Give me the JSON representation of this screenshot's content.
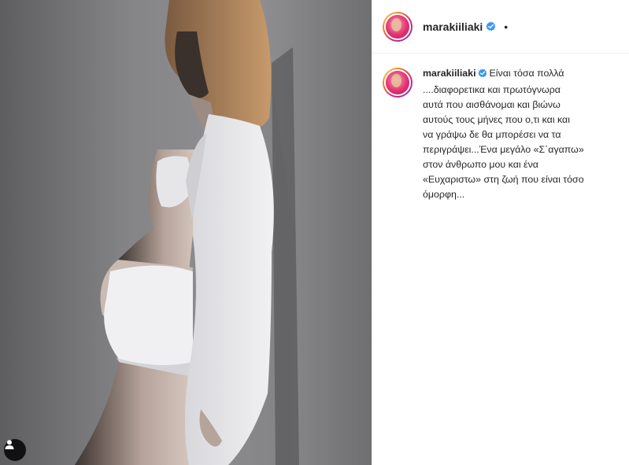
{
  "post": {
    "username": "marakiiliaki",
    "verified": true,
    "follow_separator": "•",
    "caption_lines": [
      "Είναι τόσα πολλά",
      "....διαφορετικα και πρωτόγνωρα",
      "αυτά που αισθάνομαι και βιώνω",
      "αυτούς τους μήνες που ο,τι και και",
      "να γράψω δε θα μπορέσει να τα",
      "περιγράψει...Ένα μεγάλο «Σ΄αγαπω»",
      "στον άνθρωπο μου και ένα",
      "«Ευχαριστω» στη ζωή που είναι τόσο",
      "όμορφη..."
    ]
  },
  "icons": {
    "verified": "verified-badge-icon",
    "tag": "user-tag-icon"
  },
  "colors": {
    "verified_blue": "#3897f0",
    "text": "#262626",
    "divider": "#efefef"
  }
}
